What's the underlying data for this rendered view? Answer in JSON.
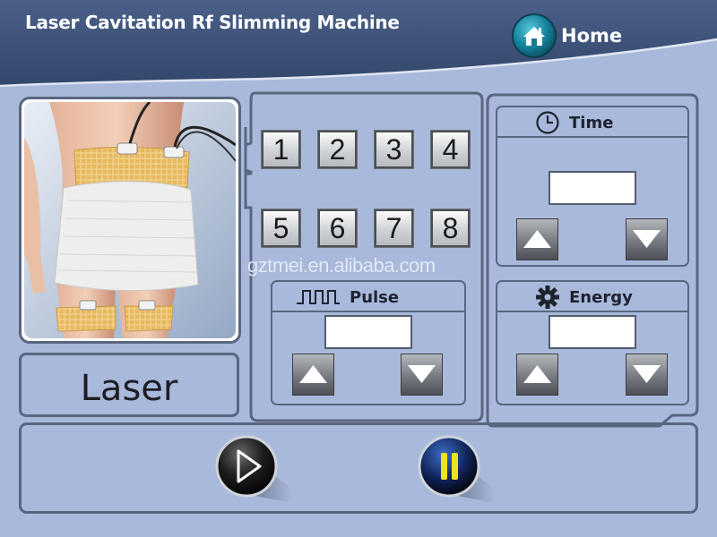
{
  "header": {
    "title": "Laser Cavitation Rf Slimming Machine",
    "home_label": "Home",
    "colors": {
      "banner": "#44587e",
      "banner_dark": "#34486d",
      "background": "#a9b9db"
    }
  },
  "mode": {
    "label": "Laser"
  },
  "channels": {
    "buttons": [
      "1",
      "2",
      "3",
      "4",
      "5",
      "6",
      "7",
      "8"
    ]
  },
  "pulse": {
    "title": "Pulse",
    "icon": "pulse-wave-icon",
    "value": ""
  },
  "time": {
    "title": "Time",
    "icon": "clock-icon",
    "value": ""
  },
  "energy": {
    "title": "Energy",
    "icon": "gear-icon",
    "value": ""
  },
  "controls": {
    "start_icon": "play-icon",
    "pause_icon": "pause-icon"
  },
  "watermark": "gztmei.en.alibaba.com"
}
